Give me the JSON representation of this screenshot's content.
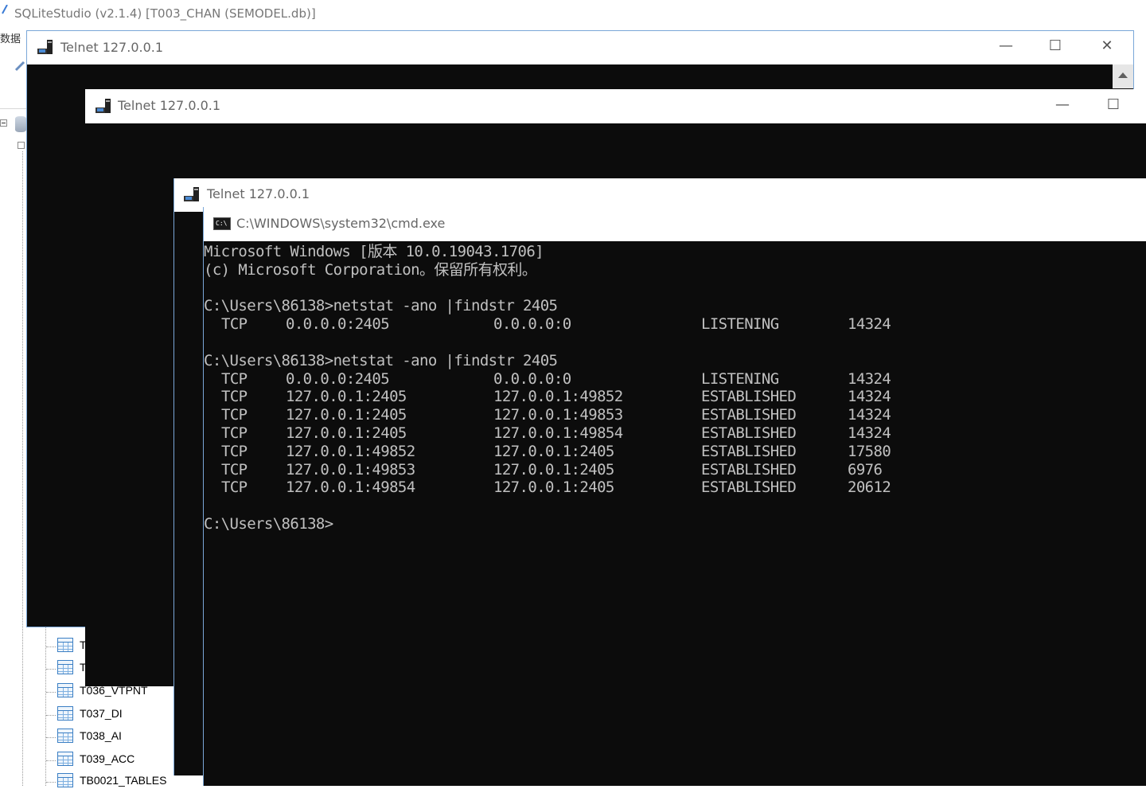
{
  "background_app": {
    "title": "SQLiteStudio (v2.1.4) [T003_CHAN (SEMODEL.db)]",
    "menu_fragment": "数据"
  },
  "tables": [
    {
      "label": "T"
    },
    {
      "label": "T"
    },
    {
      "label": "T036_VTPNT"
    },
    {
      "label": "T037_DI"
    },
    {
      "label": "T038_AI"
    },
    {
      "label": "T039_ACC"
    },
    {
      "label": "TB0021_TABLES"
    }
  ],
  "telnet_windows": [
    {
      "title": "Telnet 127.0.0.1"
    },
    {
      "title": "Telnet 127.0.0.1"
    },
    {
      "title": "Telnet 127.0.0.1"
    }
  ],
  "controls": {
    "minimize": "—",
    "maximize": "☐",
    "close": "✕"
  },
  "cmd_window": {
    "title": "C:\\WINDOWS\\system32\\cmd.exe",
    "icon_text": "C:\\",
    "header_line1": "Microsoft Windows [版本 10.0.19043.1706]",
    "header_line2": "(c) Microsoft Corporation。保留所有权利。",
    "prompt1": "C:\\Users\\86138>netstat -ano |findstr 2405",
    "result1": [
      {
        "proto": "TCP",
        "local": "0.0.0.0:2405",
        "foreign": "0.0.0.0:0",
        "state": "LISTENING",
        "pid": "14324"
      }
    ],
    "prompt2": "C:\\Users\\86138>netstat -ano |findstr 2405",
    "result2": [
      {
        "proto": "TCP",
        "local": "0.0.0.0:2405",
        "foreign": "0.0.0.0:0",
        "state": "LISTENING",
        "pid": "14324"
      },
      {
        "proto": "TCP",
        "local": "127.0.0.1:2405",
        "foreign": "127.0.0.1:49852",
        "state": "ESTABLISHED",
        "pid": "14324"
      },
      {
        "proto": "TCP",
        "local": "127.0.0.1:2405",
        "foreign": "127.0.0.1:49853",
        "state": "ESTABLISHED",
        "pid": "14324"
      },
      {
        "proto": "TCP",
        "local": "127.0.0.1:2405",
        "foreign": "127.0.0.1:49854",
        "state": "ESTABLISHED",
        "pid": "14324"
      },
      {
        "proto": "TCP",
        "local": "127.0.0.1:49852",
        "foreign": "127.0.0.1:2405",
        "state": "ESTABLISHED",
        "pid": "17580"
      },
      {
        "proto": "TCP",
        "local": "127.0.0.1:49853",
        "foreign": "127.0.0.1:2405",
        "state": "ESTABLISHED",
        "pid": "6976"
      },
      {
        "proto": "TCP",
        "local": "127.0.0.1:49854",
        "foreign": "127.0.0.1:2405",
        "state": "ESTABLISHED",
        "pid": "20612"
      }
    ],
    "prompt3": "C:\\Users\\86138>"
  },
  "colors": {
    "console_bg": "#0c0c0c",
    "console_fg": "#c0c0c0",
    "title_text": "#666666",
    "window_border": "#7aa7d8",
    "table_icon": "#3b7fc4"
  },
  "icons": {
    "telnet": "telnet-computer-icon",
    "cmd": "cmd-console-icon",
    "table": "table-grid-icon",
    "database": "database-icon",
    "scroll_up": "arrow-up-icon"
  }
}
